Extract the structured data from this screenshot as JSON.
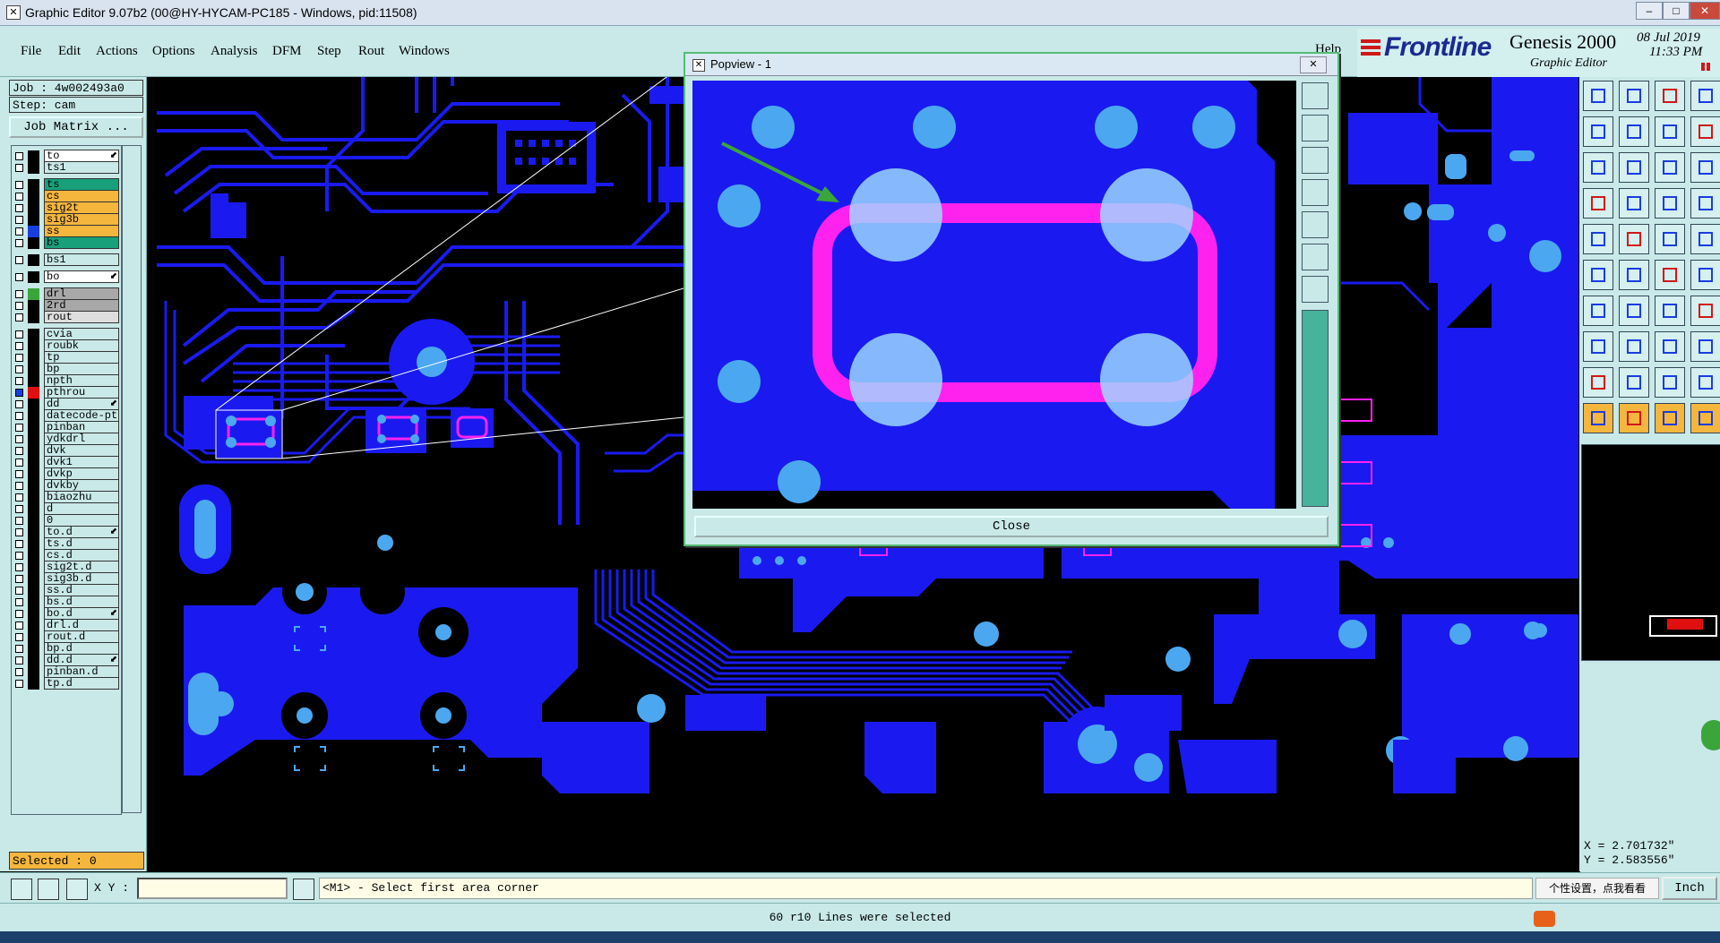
{
  "window": {
    "title": "Graphic Editor 9.07b2 (00@HY-HYCAM-PC185 - Windows, pid:11508)",
    "minimize": "–",
    "maximize": "□",
    "close": "✕"
  },
  "menu": [
    "File",
    "Edit",
    "Actions",
    "Options",
    "Analysis",
    "DFM",
    "Step",
    "Rout",
    "Windows"
  ],
  "help": "Help",
  "brand": {
    "logo": "Frontline",
    "product": "Genesis 2000",
    "subtitle": "Graphic Editor",
    "date": "08 Jul 2019",
    "time": "11:33 PM"
  },
  "job": {
    "job_label": "Job : 4w002493a0",
    "step_label": "Step: cam",
    "matrix_button": "Job Matrix ..."
  },
  "layers": [
    {
      "name": "to",
      "bg": "#ffffff",
      "swatch": "#000000",
      "arrow": true
    },
    {
      "name": "ts1",
      "bg": "#c8e9e8",
      "swatch": "#000000"
    },
    {
      "name": "ts",
      "bg": "#18a07a",
      "swatch": "#000000",
      "gap": true
    },
    {
      "name": "cs",
      "bg": "#f5b63e",
      "swatch": "#000000"
    },
    {
      "name": "sig2t",
      "bg": "#f5b63e",
      "swatch": "#000000"
    },
    {
      "name": "sig3b",
      "bg": "#f5b63e",
      "swatch": "#000000"
    },
    {
      "name": "ss",
      "bg": "#f5b63e",
      "swatch": "#1a3de0"
    },
    {
      "name": "bs",
      "bg": "#18a07a",
      "swatch": "#000000"
    },
    {
      "name": "bs1",
      "bg": "#c8e9e8",
      "swatch": "#000000",
      "gap": true
    },
    {
      "name": "bo",
      "bg": "#ffffff",
      "swatch": "#000000",
      "arrow": true,
      "gap": true
    },
    {
      "name": "drl",
      "bg": "#a8a8a8",
      "swatch": "#3aa63a",
      "gap": true
    },
    {
      "name": "2rd",
      "bg": "#a8a8a8",
      "swatch": "#000000"
    },
    {
      "name": "rout",
      "bg": "#dedede",
      "swatch": "#000000"
    },
    {
      "name": "cvia",
      "bg": "#c8e9e8",
      "swatch": "#000000",
      "gap": true
    },
    {
      "name": "roubk",
      "bg": "#c8e9e8",
      "swatch": "#000000"
    },
    {
      "name": "tp",
      "bg": "#c8e9e8",
      "swatch": "#000000"
    },
    {
      "name": "bp",
      "bg": "#c8e9e8",
      "swatch": "#000000"
    },
    {
      "name": "npth",
      "bg": "#c8e9e8",
      "swatch": "#000000"
    },
    {
      "name": "pthrou",
      "bg": "#c8e9e8",
      "swatch": "#e01010",
      "cbfill": "#1a3de0",
      "dot": true
    },
    {
      "name": "dd",
      "bg": "#c8e9e8",
      "swatch": "#000000",
      "arrow": true
    },
    {
      "name": "datecode-pt",
      "bg": "#c8e9e8",
      "swatch": "#000000"
    },
    {
      "name": "pinban",
      "bg": "#c8e9e8",
      "swatch": "#000000"
    },
    {
      "name": "ydkdrl",
      "bg": "#c8e9e8",
      "swatch": "#000000"
    },
    {
      "name": "dvk",
      "bg": "#c8e9e8",
      "swatch": "#000000"
    },
    {
      "name": "dvk1",
      "bg": "#c8e9e8",
      "swatch": "#000000"
    },
    {
      "name": "dvkp",
      "bg": "#c8e9e8",
      "swatch": "#000000"
    },
    {
      "name": "dvkby",
      "bg": "#c8e9e8",
      "swatch": "#000000"
    },
    {
      "name": "biaozhu",
      "bg": "#c8e9e8",
      "swatch": "#000000"
    },
    {
      "name": "d",
      "bg": "#c8e9e8",
      "swatch": "#000000"
    },
    {
      "name": "0",
      "bg": "#c8e9e8",
      "swatch": "#000000"
    },
    {
      "name": "to.d",
      "bg": "#c8e9e8",
      "swatch": "#000000",
      "arrow": true
    },
    {
      "name": "ts.d",
      "bg": "#c8e9e8",
      "swatch": "#000000"
    },
    {
      "name": "cs.d",
      "bg": "#c8e9e8",
      "swatch": "#000000"
    },
    {
      "name": "sig2t.d",
      "bg": "#c8e9e8",
      "swatch": "#000000"
    },
    {
      "name": "sig3b.d",
      "bg": "#c8e9e8",
      "swatch": "#000000"
    },
    {
      "name": "ss.d",
      "bg": "#c8e9e8",
      "swatch": "#000000"
    },
    {
      "name": "bs.d",
      "bg": "#c8e9e8",
      "swatch": "#000000"
    },
    {
      "name": "bo.d",
      "bg": "#c8e9e8",
      "swatch": "#000000",
      "arrow": true
    },
    {
      "name": "drl.d",
      "bg": "#c8e9e8",
      "swatch": "#000000"
    },
    {
      "name": "rout.d",
      "bg": "#c8e9e8",
      "swatch": "#000000"
    },
    {
      "name": "bp.d",
      "bg": "#c8e9e8",
      "swatch": "#000000"
    },
    {
      "name": "dd.d",
      "bg": "#c8e9e8",
      "swatch": "#000000",
      "arrow": true
    },
    {
      "name": "pinban.d",
      "bg": "#c8e9e8",
      "swatch": "#000000"
    },
    {
      "name": "tp.d",
      "bg": "#c8e9e8",
      "swatch": "#000000"
    }
  ],
  "selected_label": "Selected : 0",
  "popview": {
    "title": "Popview - 1",
    "close_label": "Close"
  },
  "coords": {
    "x": "X = 2.701732\"",
    "y": "Y = 2.583556\""
  },
  "bottom": {
    "xy_label": "X Y :",
    "xy_value": "",
    "prompt": "<M1> - Select first area corner",
    "ime_text": "个性设置，点我看看",
    "units": "Inch"
  },
  "status_message": "60 r10 Lines were selected",
  "colors": {
    "board_copper": "#1a1af0",
    "board_bg": "#000000",
    "pad": "#4ba8f0",
    "highlight": "#ff22ee",
    "panel": "#c8e9e8",
    "accent_orange": "#f5b63e"
  }
}
